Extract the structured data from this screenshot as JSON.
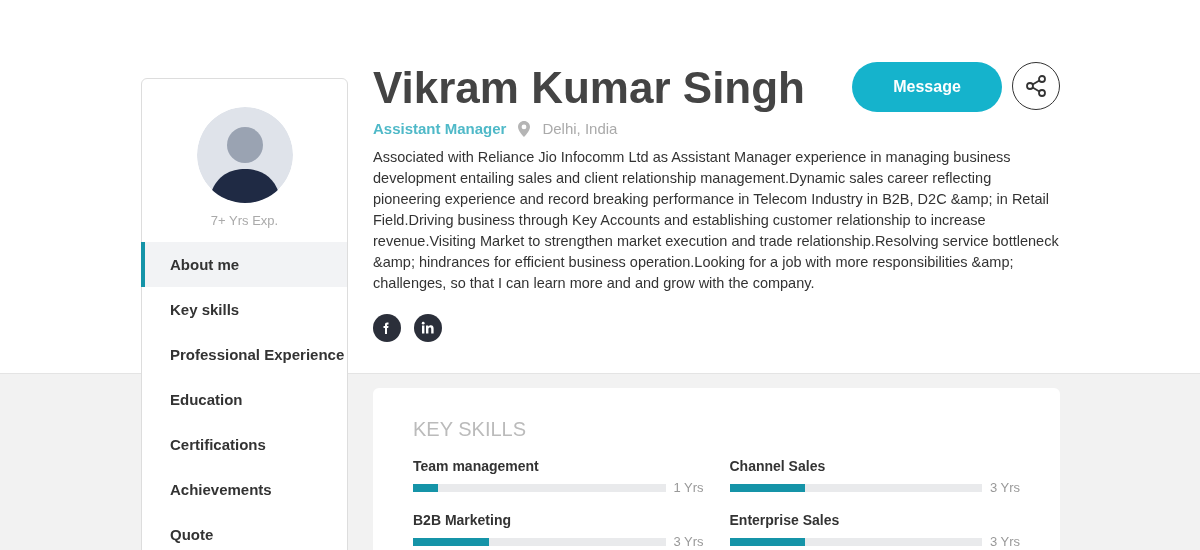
{
  "profile": {
    "experience": "7+ Yrs Exp.",
    "name": "Vikram Kumar Singh",
    "designation": "Assistant Manager",
    "location": "Delhi, India",
    "summary": "Associated with Reliance Jio Infocomm Ltd as Assistant Manager experience in managing business development entailing sales and client relationship management.Dynamic sales career reflecting pioneering experience and record breaking performance in Telecom Industry in B2B, D2C &amp; in Retail Field.Driving business through Key Accounts and establishing customer relationship to increase revenue.Visiting Market to strengthen market execution and trade relationship.Resolving service bottleneck &amp; hindrances for efficient business operation.Looking for a job with more responsibilities &amp; challenges, so that I can learn more and and grow with the company.",
    "message_button": "Message",
    "social": [
      {
        "kind": "facebook"
      },
      {
        "kind": "linkedin"
      }
    ]
  },
  "sidebar": {
    "items": [
      {
        "label": "About me",
        "selected": true
      },
      {
        "label": "Key skills",
        "selected": false
      },
      {
        "label": "Professional Experience",
        "selected": false
      },
      {
        "label": "Education",
        "selected": false
      },
      {
        "label": "Certifications",
        "selected": false
      },
      {
        "label": "Achievements",
        "selected": false
      },
      {
        "label": "Quote",
        "selected": false
      }
    ]
  },
  "key_skills": {
    "title": "KEY SKILLS",
    "skills": [
      {
        "name": "Team management",
        "level": 0.1,
        "reading": "1 Yrs"
      },
      {
        "name": "Channel Sales",
        "level": 0.3,
        "reading": "3 Yrs"
      },
      {
        "name": "B2B Marketing",
        "level": 0.3,
        "reading": "3 Yrs"
      },
      {
        "name": "Enterprise Sales",
        "level": 0.3,
        "reading": "3 Yrs"
      }
    ]
  }
}
